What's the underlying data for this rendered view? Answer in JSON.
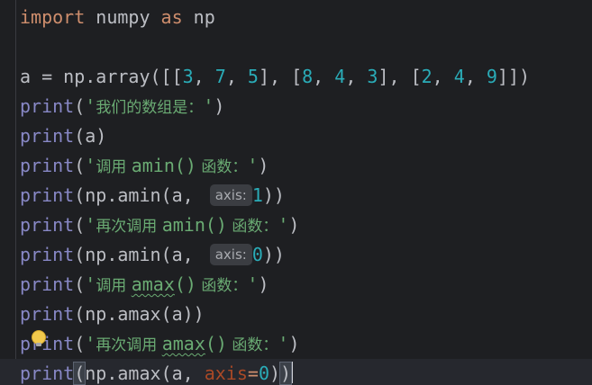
{
  "code": {
    "l1": {
      "kw1": "import",
      "mod": " numpy ",
      "kw2": "as",
      "alias": " np"
    },
    "l3": {
      "lhs": "a = np.array([[",
      "n1": "3",
      "c1": ", ",
      "n2": "7",
      "c2": ", ",
      "n3": "5",
      "s1": "], [",
      "n4": "8",
      "c3": ", ",
      "n5": "4",
      "c4": ", ",
      "n6": "3",
      "s2": "], [",
      "n7": "2",
      "c5": ", ",
      "n8": "4",
      "c6": ", ",
      "n9": "9",
      "end": "]])"
    },
    "l4": {
      "fn": "print",
      "open": "(",
      "q1": "'",
      "text": "我们的数组是：",
      "q2": "'",
      "close": ")"
    },
    "l5": {
      "fn": "print",
      "args": "(a)"
    },
    "l6": {
      "fn": "print",
      "open": "(",
      "s1": "'",
      "cn1": "调用 ",
      "s2": "amin()",
      "cn2": " 函数：",
      "s3": "'",
      "close": ")"
    },
    "l7": {
      "fn": "print",
      "pre": "(np.amin(a, ",
      "hint": "axis:",
      "num": "1",
      "close": "))"
    },
    "l8": {
      "fn": "print",
      "open": "(",
      "s1": "'",
      "cn1": "再次调用 ",
      "s2": "amin()",
      "cn2": " 函数：",
      "s3": "'",
      "close": ")"
    },
    "l9": {
      "fn": "print",
      "pre": "(np.amin(a, ",
      "hint": "axis:",
      "num": "0",
      "close": "))"
    },
    "l10": {
      "fn": "print",
      "open": "(",
      "s1": "'",
      "cn1": "调用 ",
      "s2": "amax",
      "s3": "()",
      "cn2": " 函数：",
      "s4": "'",
      "close": ")"
    },
    "l11": {
      "fn": "print",
      "args": "(np.amax(a))"
    },
    "l12": {
      "fn": "print",
      "open": "(",
      "s1": "'",
      "cn1": "再次调用 ",
      "s2": "amax",
      "s3": "()",
      "cn2": " 函数：",
      "s4": "'",
      "close": ")"
    },
    "l13": {
      "fn": "print",
      "open": "(",
      "mid": "np.amax(a, ",
      "kwarg": "axis",
      "eq": "=",
      "num": "0",
      "inner": ")",
      "close": ")"
    }
  },
  "colors": {
    "background": "#1e1f22",
    "keyword": "#cf8e6d",
    "string": "#6aab73",
    "number": "#2aacb8",
    "function": "#56a8f5",
    "param": "#aa4926",
    "bulb": "#f2c94c"
  },
  "icons": {
    "intention": "lightbulb-icon"
  }
}
